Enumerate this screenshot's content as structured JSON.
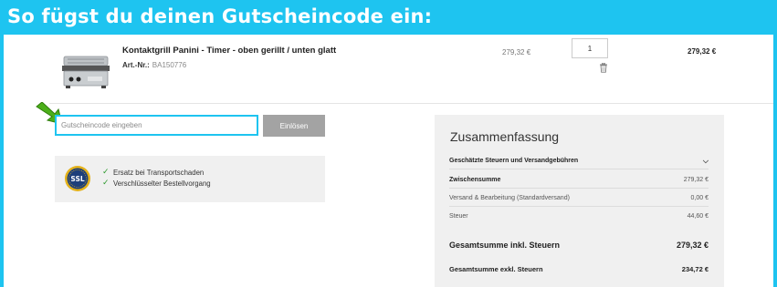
{
  "banner": {
    "title": "So fügst du deinen Gutscheincode ein:"
  },
  "cart": {
    "item": {
      "name": "Kontaktgrill Panini - Timer - oben gerillt / unten glatt",
      "partno_label": "Art.-Nr.:",
      "partno": "BA150776",
      "unit_price": "279,32 €",
      "quantity": "1",
      "total": "279,32 €"
    }
  },
  "coupon": {
    "placeholder": "Gutscheincode eingeben",
    "button": "Einlösen"
  },
  "trust": {
    "badge": "SSL",
    "items": [
      "Ersatz bei Transportschaden",
      "Verschlüsselter Bestellvorgang"
    ]
  },
  "summary": {
    "title": "Zusammenfassung",
    "estimate_label": "Geschätzte Steuern und Versandgebühren",
    "subtotal_label": "Zwischensumme",
    "subtotal_value": "279,32 €",
    "shipping_label": "Versand & Bearbeitung (Standardversand)",
    "shipping_value": "0,00 €",
    "tax_label": "Steuer",
    "tax_value": "44,60 €",
    "grand_total_label": "Gesamtsumme inkl. Steuern",
    "grand_total_value": "279,32 €",
    "net_total_label": "Gesamtsumme exkl. Steuern",
    "net_total_value": "234,72 €"
  },
  "colors": {
    "banner_bg": "#1ec4f0",
    "check": "#2e9a2e",
    "arrow": "#4caf1a",
    "button_bg": "#a3a3a3"
  }
}
